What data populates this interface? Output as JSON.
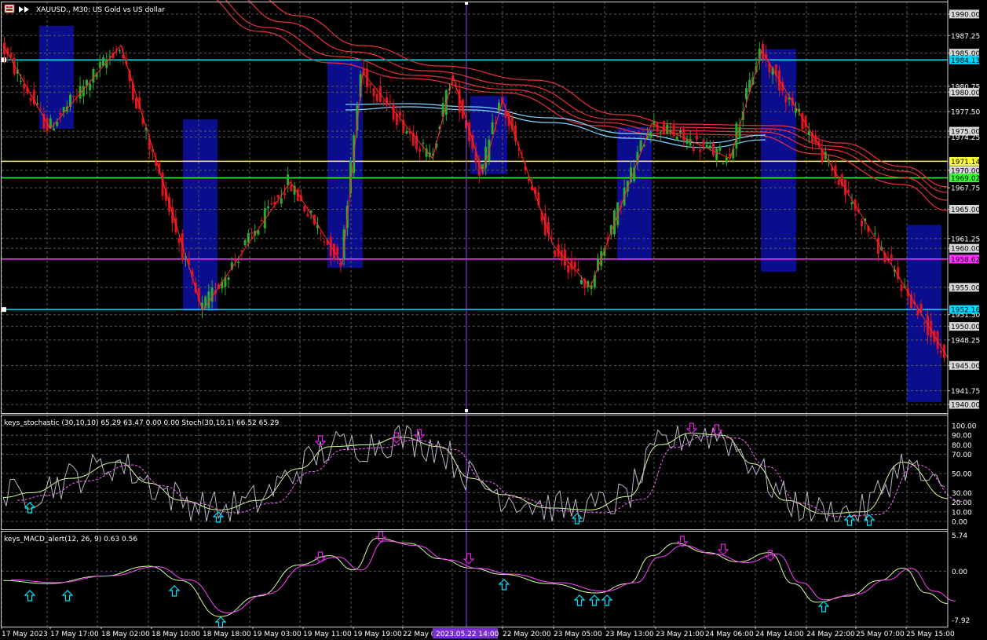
{
  "header": {
    "symbol_title": "XAUUSD., M30:  US Gold vs US dollar"
  },
  "indicators": {
    "stochastic_title": "keys_stochastic (30,10,10) 65.29 63.47 0.00 0.00 Stoch(30,10,1) 66.52 65.29",
    "macd_title": "keys_MACD_alert(12, 26, 9) 0.63 0.56"
  },
  "price_axis": {
    "labels": [
      "1990.00",
      "1987.25",
      "1985.00",
      "1980.75",
      "1980.00",
      "1977.50",
      "1975.00",
      "1974.25",
      "1970.00",
      "1967.75",
      "1965.00",
      "1961.25",
      "1960.00",
      "1955.00",
      "1951.50",
      "1950.00",
      "1948.25",
      "1945.00",
      "1941.75",
      "1940.00"
    ]
  },
  "horizontal_levels": [
    {
      "price": 1984.13,
      "label": "1984.13",
      "color": "#00d8ff"
    },
    {
      "price": 1971.14,
      "label": "1971.14",
      "color": "#ffff33"
    },
    {
      "price": 1969.02,
      "label": "1969.02",
      "color": "#33ff33"
    },
    {
      "price": 1958.62,
      "label": "1958.62",
      "color": "#ff33ff"
    },
    {
      "price": 1952.16,
      "label": "1952.16",
      "color": "#00d8ff"
    }
  ],
  "stoch_axis": {
    "labels": [
      "100.00",
      "90.00",
      "80.00",
      "70.00",
      "50.00",
      "30.00",
      "20.00",
      "10.00",
      "0.00"
    ]
  },
  "macd_axis": {
    "labels": [
      "5.74",
      "0.00",
      "-7.92"
    ]
  },
  "time_axis": {
    "labels": [
      "17 May 2023",
      "17 May 17:00",
      "18 May 02:00",
      "18 May 10:00",
      "18 May 18:00",
      "19 May 03:00",
      "19 May 11:00",
      "19 May 19:00",
      "22 May 04:00",
      "22 May 20:00",
      "23 May 05:00",
      "23 May 13:00",
      "23 May 21:00",
      "24 May 06:00",
      "24 May 14:00",
      "24 May 22:00",
      "25 May 07:00",
      "25 May 15:00"
    ],
    "highlight": "2023.05.22 14:00"
  },
  "colors": {
    "background": "#000000",
    "grid": "#5a5a5a",
    "bull": "#2eaa2e",
    "bear": "#e0141e",
    "box": "#0a0e8c",
    "ma": "#e8303c",
    "ma_blue": "#7fd6ff",
    "stoch_fast": "#b8b8c8",
    "stoch_main": "#d6ff9e",
    "stoch_signal": "#ff66ff",
    "macd_main": "#d6ff9e",
    "macd_signal": "#ff44ff",
    "arrow_up": "#00e5ff",
    "arrow_down": "#e020e0",
    "vline": "#9040ff"
  },
  "chart_data": {
    "type": "line",
    "title": "XAUUSD., M30:  US Gold vs US dollar",
    "y_range": [
      1938.9,
      1991.6
    ],
    "zigzag": [
      {
        "t": "17 May 2023",
        "price": 1986.0
      },
      {
        "t": "17 May 10:30",
        "price": 1975.3
      },
      {
        "t": "18 May 03:00",
        "price": 1986.0
      },
      {
        "t": "18 May 18:00",
        "price": 1952.0
      },
      {
        "t": "19 May 05:00",
        "price": 1968.5
      },
      {
        "t": "19 May 12:00",
        "price": 1958.0
      },
      {
        "t": "19 May 13:30",
        "price": 1982.5
      },
      {
        "t": "22 May 06:00",
        "price": 1971.5
      },
      {
        "t": "22 May 09:00",
        "price": 1982.0
      },
      {
        "t": "22 May 13:30",
        "price": 1969.5
      },
      {
        "t": "22 May 17:00",
        "price": 1979.0
      },
      {
        "t": "23 May 01:00",
        "price": 1960.5
      },
      {
        "t": "23 May 06:00",
        "price": 1955.0
      },
      {
        "t": "23 May 14:00",
        "price": 1976.0
      },
      {
        "t": "24 May 05:00",
        "price": 1971.5
      },
      {
        "t": "24 May 12:00",
        "price": 1985.3
      },
      {
        "t": "25 May 15:30",
        "price": 1946.0
      }
    ],
    "moving_averages_count": 4,
    "stochastic": {
      "levels": [
        100,
        90,
        80,
        70,
        50,
        30,
        20,
        10,
        0
      ],
      "last_main": 65.29,
      "last_signal": 63.47
    },
    "macd": {
      "range": [
        -7.92,
        5.74
      ],
      "last_main": 0.63,
      "last_signal": 0.56
    }
  }
}
